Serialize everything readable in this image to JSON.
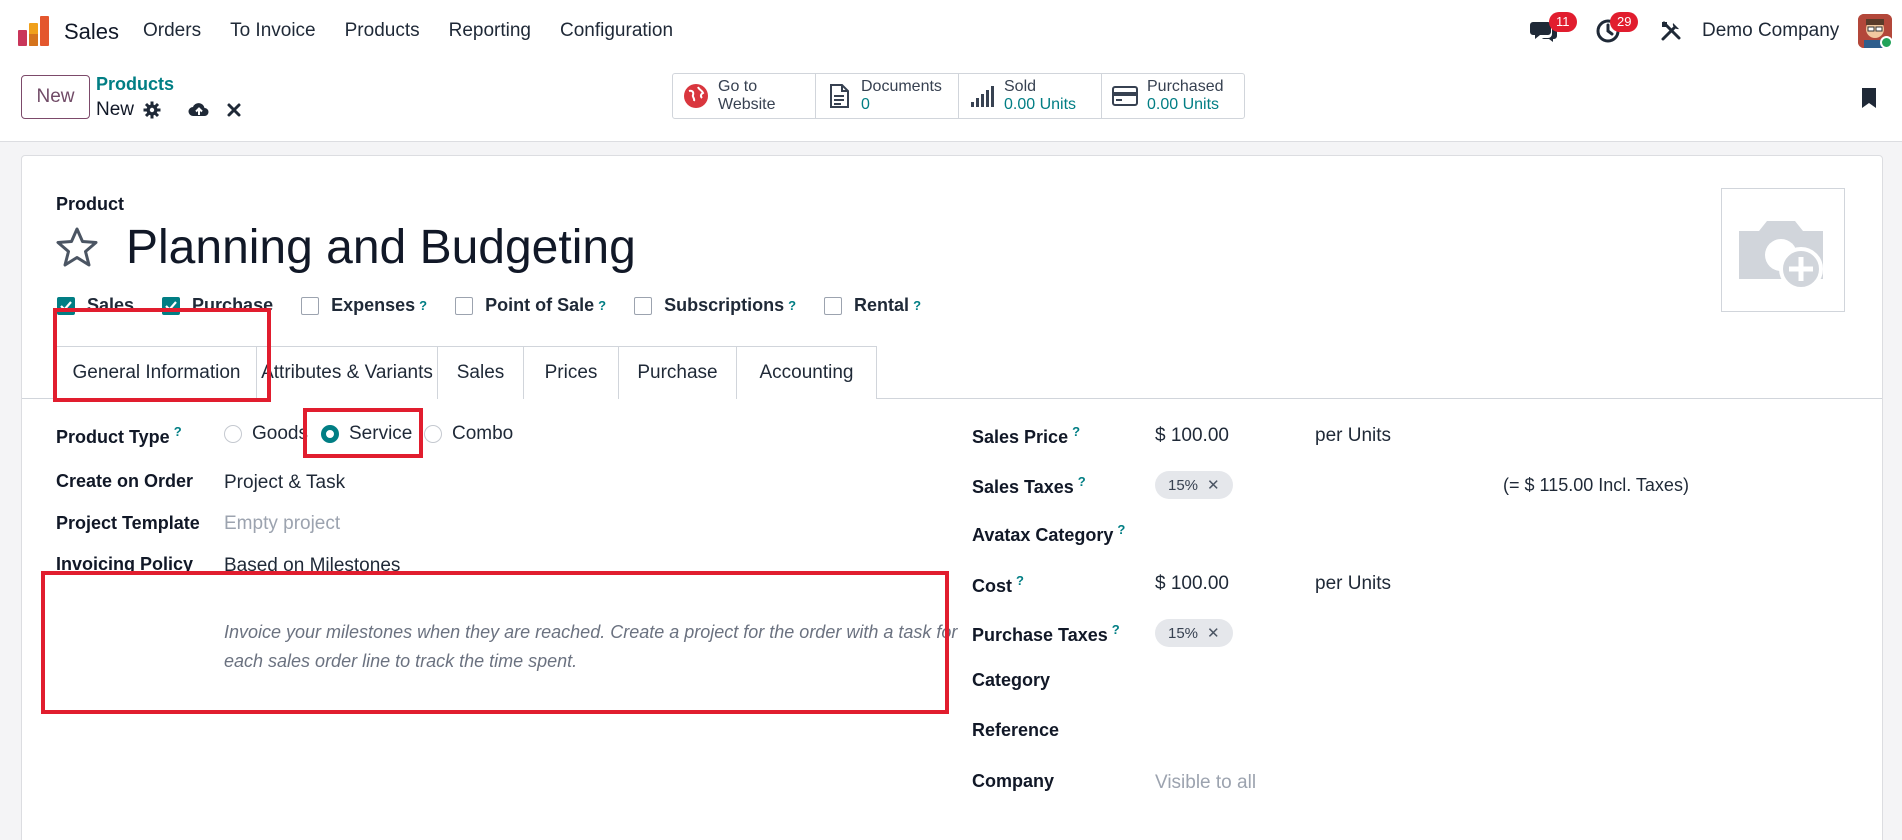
{
  "navbar": {
    "app_name": "Sales",
    "menu": [
      "Orders",
      "To Invoice",
      "Products",
      "Reporting",
      "Configuration"
    ],
    "messages_count": "11",
    "activities_count": "29",
    "company": "Demo Company"
  },
  "control_panel": {
    "new_label": "New",
    "breadcrumb_parent": "Products",
    "breadcrumb_current": "New",
    "smart_buttons": [
      {
        "line1": "Go to",
        "line2": "Website"
      },
      {
        "line1": "Documents",
        "line2": "0"
      },
      {
        "line1": "Sold",
        "line2": "0.00 Units"
      },
      {
        "line1": "Purchased",
        "line2": "0.00 Units"
      }
    ]
  },
  "form": {
    "product_label": "Product",
    "product_name": "Planning and Budgeting",
    "checkboxes": [
      {
        "label": "Sales",
        "checked": true,
        "help": ""
      },
      {
        "label": "Purchase",
        "checked": true,
        "help": ""
      },
      {
        "label": "Expenses",
        "checked": false,
        "help": "?"
      },
      {
        "label": "Point of Sale",
        "checked": false,
        "help": "?"
      },
      {
        "label": "Subscriptions",
        "checked": false,
        "help": "?"
      },
      {
        "label": "Rental",
        "checked": false,
        "help": "?"
      }
    ],
    "tabs": [
      "General Information",
      "Attributes & Variants",
      "Sales",
      "Prices",
      "Purchase",
      "Accounting"
    ],
    "active_tab": "General Information",
    "left": {
      "product_type_label": "Product Type",
      "product_type_options": [
        "Goods",
        "Service",
        "Combo"
      ],
      "product_type_selected": "Service",
      "create_on_order_label": "Create on Order",
      "create_on_order_value": "Project & Task",
      "project_template_label": "Project Template",
      "project_template_placeholder": "Empty project",
      "invoicing_policy_label": "Invoicing Policy",
      "invoicing_policy_value": "Based on Milestones",
      "invoicing_policy_hint": "Invoice your milestones when they are reached. Create a project for the order with a task for each sales order line to track the time spent."
    },
    "right": {
      "sales_price_label": "Sales Price",
      "sales_price_value": "$ 100.00",
      "sales_price_unit": "per Units",
      "sales_taxes_label": "Sales Taxes",
      "sales_taxes_tag": "15%",
      "sales_taxes_incl": "(= $ 115.00 Incl. Taxes)",
      "avatax_label": "Avatax Category",
      "cost_label": "Cost",
      "cost_value": "$ 100.00",
      "cost_unit": "per Units",
      "purchase_taxes_label": "Purchase Taxes",
      "purchase_taxes_tag": "15%",
      "category_label": "Category",
      "reference_label": "Reference",
      "company_label": "Company",
      "company_placeholder": "Visible to all"
    }
  },
  "colors": {
    "brand": "#714b67",
    "accent": "#017e84",
    "highlight": "#e11d2e"
  }
}
